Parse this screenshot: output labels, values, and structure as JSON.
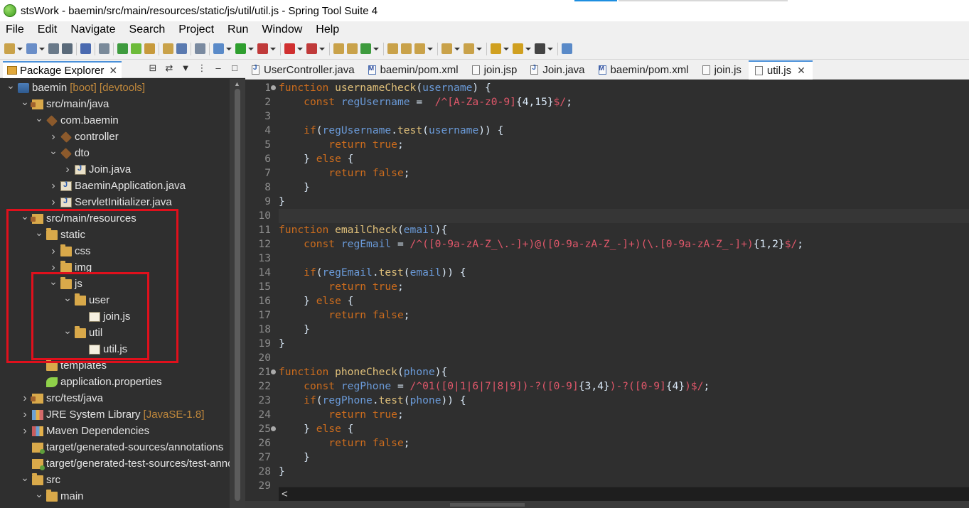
{
  "window": {
    "title": "stsWork - baemin/src/main/resources/static/js/util/util.js - Spring Tool Suite 4"
  },
  "menubar": [
    "File",
    "Edit",
    "Navigate",
    "Search",
    "Project",
    "Run",
    "Window",
    "Help"
  ],
  "explorer": {
    "tab_label": "Package Explorer",
    "tree": [
      {
        "label": "baemin",
        "extra": "[boot] [devtools]",
        "icon": "project",
        "depth": 0,
        "open": true
      },
      {
        "label": "src/main/java",
        "icon": "srcfolder",
        "depth": 1,
        "open": true
      },
      {
        "label": "com.baemin",
        "icon": "package",
        "depth": 2,
        "open": true
      },
      {
        "label": "controller",
        "icon": "package",
        "depth": 3,
        "open": false
      },
      {
        "label": "dto",
        "icon": "package",
        "depth": 3,
        "open": true
      },
      {
        "label": "Join.java",
        "icon": "java",
        "depth": 4,
        "open": false
      },
      {
        "label": "BaeminApplication.java",
        "icon": "java",
        "depth": 3,
        "open": false
      },
      {
        "label": "ServletInitializer.java",
        "icon": "java",
        "depth": 3,
        "open": false
      },
      {
        "label": "src/main/resources",
        "icon": "srcfolder",
        "depth": 1,
        "open": true
      },
      {
        "label": "static",
        "icon": "folder",
        "depth": 2,
        "open": true
      },
      {
        "label": "css",
        "icon": "folder",
        "depth": 3,
        "open": false
      },
      {
        "label": "img",
        "icon": "folder",
        "depth": 3,
        "open": false
      },
      {
        "label": "js",
        "icon": "folder",
        "depth": 3,
        "open": true
      },
      {
        "label": "user",
        "icon": "folder",
        "depth": 4,
        "open": true
      },
      {
        "label": "join.js",
        "icon": "jsfile",
        "depth": 5,
        "leaf": true
      },
      {
        "label": "util",
        "icon": "folder",
        "depth": 4,
        "open": true
      },
      {
        "label": "util.js",
        "icon": "jsfile",
        "depth": 5,
        "leaf": true
      },
      {
        "label": "templates",
        "icon": "folder",
        "depth": 2,
        "leaf": true
      },
      {
        "label": "application.properties",
        "icon": "props",
        "depth": 2,
        "leaf": true
      },
      {
        "label": "src/test/java",
        "icon": "srcfolder",
        "depth": 1,
        "open": false
      },
      {
        "label": "JRE System Library",
        "extra": "[JavaSE-1.8]",
        "icon": "lib",
        "depth": 1,
        "open": false
      },
      {
        "label": "Maven Dependencies",
        "icon": "maven",
        "depth": 1,
        "open": false
      },
      {
        "label": "target/generated-sources/annotations",
        "icon": "target",
        "depth": 1,
        "leaf": true
      },
      {
        "label": "target/generated-test-sources/test-annotations",
        "icon": "target",
        "depth": 1,
        "leaf": true
      },
      {
        "label": "src",
        "icon": "folder",
        "depth": 1,
        "open": true
      },
      {
        "label": "main",
        "icon": "folder",
        "depth": 2,
        "open": true
      }
    ]
  },
  "editor": {
    "tabs": [
      {
        "label": "UserController.java",
        "icon": "j"
      },
      {
        "label": "baemin/pom.xml",
        "icon": "m"
      },
      {
        "label": "join.jsp",
        "icon": "f"
      },
      {
        "label": "Join.java",
        "icon": "j"
      },
      {
        "label": "baemin/pom.xml",
        "icon": "m"
      },
      {
        "label": "join.js",
        "icon": "f"
      },
      {
        "label": "util.js",
        "icon": "f",
        "active": true
      }
    ],
    "current_line": 10,
    "lines": [
      {
        "n": "1",
        "fold": true,
        "t": [
          [
            "k",
            "function "
          ],
          [
            "f",
            "usernameCheck"
          ],
          [
            "n",
            "("
          ],
          [
            "b",
            "username"
          ],
          [
            "n",
            ") {"
          ]
        ]
      },
      {
        "n": "2",
        "t": [
          [
            "n",
            "    "
          ],
          [
            "k",
            "const "
          ],
          [
            "b",
            "regUsername"
          ],
          [
            "n",
            " =  "
          ],
          [
            "rx",
            "/^[A-Za-z0-9]"
          ],
          [
            "n",
            "{4,15}"
          ],
          [
            "rx",
            "$/"
          ],
          [
            "n",
            ";"
          ]
        ]
      },
      {
        "n": "3",
        "t": []
      },
      {
        "n": "4",
        "t": [
          [
            "n",
            "    "
          ],
          [
            "k",
            "if"
          ],
          [
            "n",
            "("
          ],
          [
            "b",
            "regUsername"
          ],
          [
            "n",
            "."
          ],
          [
            "f",
            "test"
          ],
          [
            "n",
            "("
          ],
          [
            "b",
            "username"
          ],
          [
            "n",
            ")) {"
          ]
        ]
      },
      {
        "n": "5",
        "t": [
          [
            "n",
            "        "
          ],
          [
            "k",
            "return "
          ],
          [
            "k",
            "true"
          ],
          [
            "n",
            ";"
          ]
        ]
      },
      {
        "n": "6",
        "t": [
          [
            "n",
            "    } "
          ],
          [
            "k",
            "else "
          ],
          [
            "n",
            "{"
          ]
        ]
      },
      {
        "n": "7",
        "t": [
          [
            "n",
            "        "
          ],
          [
            "k",
            "return "
          ],
          [
            "k",
            "false"
          ],
          [
            "n",
            ";"
          ]
        ]
      },
      {
        "n": "8",
        "t": [
          [
            "n",
            "    }"
          ]
        ]
      },
      {
        "n": "9",
        "t": [
          [
            "n",
            "}"
          ]
        ]
      },
      {
        "n": "10",
        "t": []
      },
      {
        "n": "11",
        "t": [
          [
            "k",
            "function "
          ],
          [
            "f",
            "emailCheck"
          ],
          [
            "n",
            "("
          ],
          [
            "b",
            "email"
          ],
          [
            "n",
            "){"
          ]
        ]
      },
      {
        "n": "12",
        "t": [
          [
            "n",
            "    "
          ],
          [
            "k",
            "const "
          ],
          [
            "b",
            "regEmail"
          ],
          [
            "n",
            " = "
          ],
          [
            "rx",
            "/^([0-9a-zA-Z_\\.-]+)@([0-9a-zA-Z_-]+)(\\.[0-9a-zA-Z_-]+)"
          ],
          [
            "n",
            "{1,2}"
          ],
          [
            "rx",
            "$/"
          ],
          [
            "n",
            ";"
          ]
        ]
      },
      {
        "n": "13",
        "t": []
      },
      {
        "n": "14",
        "t": [
          [
            "n",
            "    "
          ],
          [
            "k",
            "if"
          ],
          [
            "n",
            "("
          ],
          [
            "b",
            "regEmail"
          ],
          [
            "n",
            "."
          ],
          [
            "f",
            "test"
          ],
          [
            "n",
            "("
          ],
          [
            "b",
            "email"
          ],
          [
            "n",
            ")) {"
          ]
        ]
      },
      {
        "n": "15",
        "t": [
          [
            "n",
            "        "
          ],
          [
            "k",
            "return "
          ],
          [
            "k",
            "true"
          ],
          [
            "n",
            ";"
          ]
        ]
      },
      {
        "n": "16",
        "t": [
          [
            "n",
            "    } "
          ],
          [
            "k",
            "else "
          ],
          [
            "n",
            "{"
          ]
        ]
      },
      {
        "n": "17",
        "t": [
          [
            "n",
            "        "
          ],
          [
            "k",
            "return "
          ],
          [
            "k",
            "false"
          ],
          [
            "n",
            ";"
          ]
        ]
      },
      {
        "n": "18",
        "t": [
          [
            "n",
            "    }"
          ]
        ]
      },
      {
        "n": "19",
        "t": [
          [
            "n",
            "}"
          ]
        ]
      },
      {
        "n": "20",
        "t": []
      },
      {
        "n": "21",
        "fold": true,
        "t": [
          [
            "k",
            "function "
          ],
          [
            "f",
            "phoneCheck"
          ],
          [
            "n",
            "("
          ],
          [
            "b",
            "phone"
          ],
          [
            "n",
            "){"
          ]
        ]
      },
      {
        "n": "22",
        "t": [
          [
            "n",
            "    "
          ],
          [
            "k",
            "const "
          ],
          [
            "b",
            "regPhone"
          ],
          [
            "n",
            " = "
          ],
          [
            "rx",
            "/^01([0|1|6|7|8|9])-?([0-9]"
          ],
          [
            "n",
            "{3,4}"
          ],
          [
            "rx",
            ")-?([0-9]"
          ],
          [
            "n",
            "{4}"
          ],
          [
            "rx",
            ")$/"
          ],
          [
            "n",
            ";"
          ]
        ]
      },
      {
        "n": "23",
        "t": [
          [
            "n",
            "    "
          ],
          [
            "k",
            "if"
          ],
          [
            "n",
            "("
          ],
          [
            "b",
            "regPhone"
          ],
          [
            "n",
            "."
          ],
          [
            "f",
            "test"
          ],
          [
            "n",
            "("
          ],
          [
            "b",
            "phone"
          ],
          [
            "n",
            ")) {"
          ]
        ]
      },
      {
        "n": "24",
        "t": [
          [
            "n",
            "        "
          ],
          [
            "k",
            "return "
          ],
          [
            "k",
            "true"
          ],
          [
            "n",
            ";"
          ]
        ]
      },
      {
        "n": "25",
        "fold": true,
        "t": [
          [
            "n",
            "    } "
          ],
          [
            "k",
            "else "
          ],
          [
            "n",
            "{"
          ]
        ]
      },
      {
        "n": "26",
        "t": [
          [
            "n",
            "        "
          ],
          [
            "k",
            "return "
          ],
          [
            "k",
            "false"
          ],
          [
            "n",
            ";"
          ]
        ]
      },
      {
        "n": "27",
        "t": [
          [
            "n",
            "    }"
          ]
        ]
      },
      {
        "n": "28",
        "t": [
          [
            "n",
            "}"
          ]
        ]
      },
      {
        "n": "29",
        "t": []
      }
    ]
  },
  "hscroll": {
    "left_arrow": "<"
  }
}
